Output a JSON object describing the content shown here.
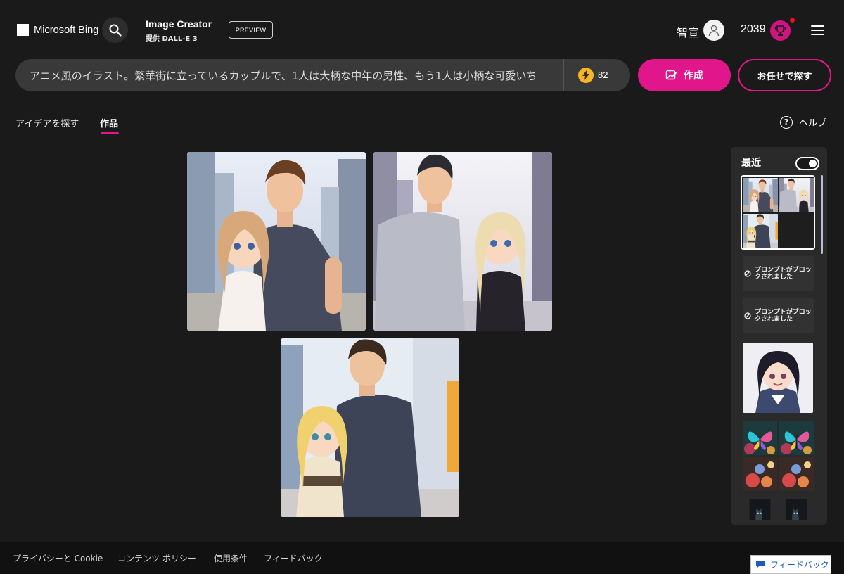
{
  "header": {
    "brand": "Microsoft Bing",
    "product_title": "Image Creator",
    "product_subtitle": "提供 DALL-E 3",
    "badge": "PREVIEW",
    "user_name": "智宣",
    "points": "2039",
    "icons": [
      "windows-logo-icon",
      "search-icon",
      "user-avatar-icon",
      "rewards-trophy-icon",
      "hamburger-menu-icon"
    ]
  },
  "prompt": {
    "value": "アニメ風のイラスト。繁華街に立っているカップルで、1人は大柄な中年の男性、もう1人は小柄な可愛いち",
    "boosts": "82",
    "create_label": "作成",
    "surprise_label": "お任せで探す"
  },
  "tabs": [
    {
      "label": "アイデアを探す",
      "active": false
    },
    {
      "label": "作品",
      "active": true
    }
  ],
  "help_label": "ヘルプ",
  "gallery": {
    "tiles": [
      {
        "kind": "anime-couple-image"
      },
      {
        "kind": "anime-couple-image"
      },
      {
        "kind": "anime-couple-image"
      }
    ]
  },
  "sidebar": {
    "title": "最近",
    "toggle_on": true,
    "blocked_label": "プロンプトがブロックされました",
    "entries": [
      "image-set",
      "blocked",
      "blocked",
      "single-image",
      "image-set",
      "image-set-partial"
    ]
  },
  "footer": {
    "links": [
      "プライバシーと Cookie",
      "コンテンツ ポリシー",
      "使用条件",
      "フィードバック"
    ],
    "feedback_button": "フィードバック"
  },
  "colors": {
    "background": "#1b1a1a",
    "accent_pink": "#e0168a",
    "prompt_bar": "#3a3939",
    "sidebar": "#2b2a2a",
    "footer": "#111111",
    "boost_gold": "#f5b526"
  }
}
